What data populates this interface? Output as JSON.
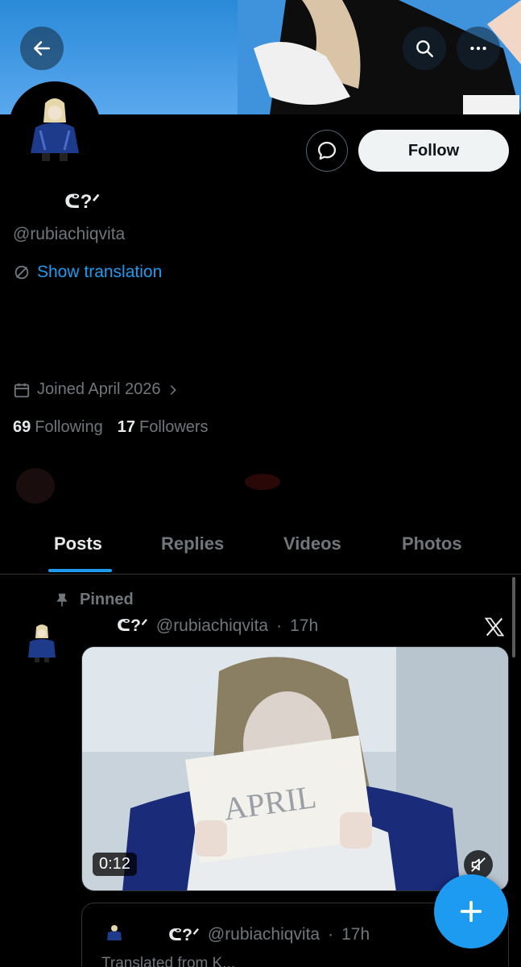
{
  "profile": {
    "display_name": "ᕦ?ᐟ",
    "handle": "@rubiachiqvita",
    "follow_label": "Follow",
    "translate_label": "Show translation",
    "joined": "Joined April 2026",
    "following_count": "69",
    "following_label": "Following",
    "followers_count": "17",
    "followers_label": "Followers"
  },
  "tabs": [
    {
      "label": "Posts",
      "active": true
    },
    {
      "label": "Replies",
      "active": false
    },
    {
      "label": "Videos",
      "active": false
    },
    {
      "label": "Photos",
      "active": false
    }
  ],
  "post": {
    "pinned_label": "Pinned",
    "author_name": "ᕦ?ᐟ",
    "author_handle": "@rubiachiqvita",
    "dot": "·",
    "time": "17h",
    "video_duration": "0:12",
    "quote": {
      "author_name": "ᕦ?ᐟ",
      "author_handle": "@rubiachiqvita",
      "dot": "·",
      "time": "17h",
      "subtext": "Translated from K..."
    }
  },
  "colors": {
    "accent": "#1d9bf0",
    "background": "#000000",
    "muted": "#71767b",
    "text": "#e7e9ea"
  },
  "icons": [
    "back-arrow-icon",
    "search-icon",
    "more-icon",
    "message-icon",
    "translate-icon",
    "calendar-icon",
    "chevron-right-icon",
    "pin-icon",
    "x-logo-icon",
    "mute-icon",
    "plus-icon"
  ]
}
